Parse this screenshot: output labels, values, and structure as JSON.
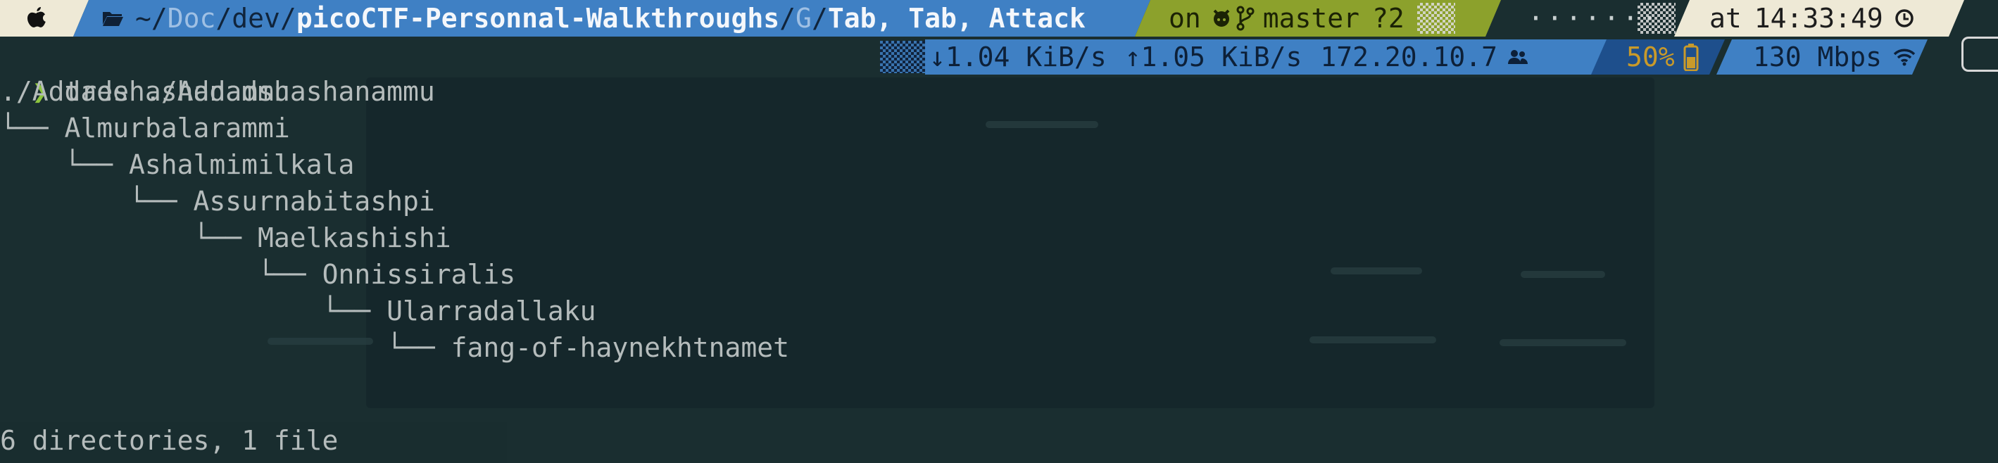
{
  "prompt_top": {
    "apple_icon": "apple-icon",
    "folder_icon": "folder-open-icon",
    "path_home": "~/",
    "path_doc": "Doc",
    "path_sep1": "/",
    "path_dev": "dev/",
    "path_repo": "picoCTF-Personnal-Walkthroughs",
    "path_sep2": "/",
    "path_g": "G",
    "path_sep3": "/",
    "path_current": "Tab, Tab, Attack",
    "git_on": "on",
    "git_icon": "github-icon",
    "branch_icon": "git-branch-icon",
    "git_branch": "master",
    "git_status": "?2",
    "time_at": "at",
    "time_value": "14:33:49",
    "clock_icon": "clock-icon"
  },
  "prompt_second": {
    "down_speed": "↓1.04 KiB/s",
    "up_speed": "↑1.05 KiB/s",
    "ip": "172.20.10.7",
    "users_icon": "users-icon",
    "battery_percent": "50%",
    "battery_icon": "battery-icon",
    "wifi_speed": "130 Mbps",
    "wifi_icon": "wifi-icon"
  },
  "command": {
    "prompt_symbol": "❯",
    "text": "tree ./Addadshashanammu"
  },
  "tree": {
    "root": "./Addadshashanammu",
    "lines": [
      {
        "branch": "└── ",
        "name": "Almurbalarammi"
      },
      {
        "branch": "    └── ",
        "name": "Ashalmimilkala"
      },
      {
        "branch": "        └── ",
        "name": "Assurnabitashpi"
      },
      {
        "branch": "            └── ",
        "name": "Maelkashishi"
      },
      {
        "branch": "                └── ",
        "name": "Onnissiralis"
      },
      {
        "branch": "                    └── ",
        "name": "Ularradallaku"
      },
      {
        "branch": "                        └── ",
        "name": "fang-of-haynekhtnamet"
      }
    ],
    "summary": "6 directories, 1 file"
  }
}
